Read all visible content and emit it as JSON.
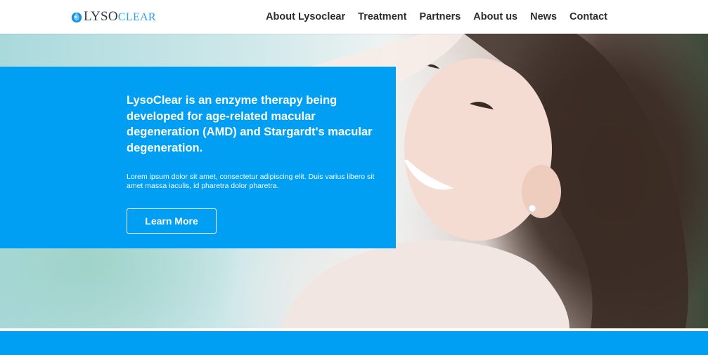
{
  "header": {
    "logo": {
      "part_one": "LYSO",
      "part_two": "CLEAR",
      "icon": "droplet-icon"
    },
    "nav": [
      {
        "label": "About Lysoclear"
      },
      {
        "label": "Treatment"
      },
      {
        "label": "Partners"
      },
      {
        "label": "About us"
      },
      {
        "label": "News"
      },
      {
        "label": "Contact"
      }
    ]
  },
  "hero": {
    "headline": "LysoClear is an enzyme therapy being developed for age-related macular degeneration (AMD) and Stargardt's macular degeneration.",
    "body": "Lorem ipsum dolor sit amet, consectetur adipiscing elit. Duis varius libero sit amet massa iaculis, id pharetra dolor pharetra.",
    "cta_label": "Learn More",
    "background_image": "smiling-woman-photo"
  },
  "colors": {
    "accent": "#009ff4",
    "nav_text": "#2c2c2c",
    "logo_dark": "#2e3a4a",
    "logo_light": "#2aa3e8"
  }
}
